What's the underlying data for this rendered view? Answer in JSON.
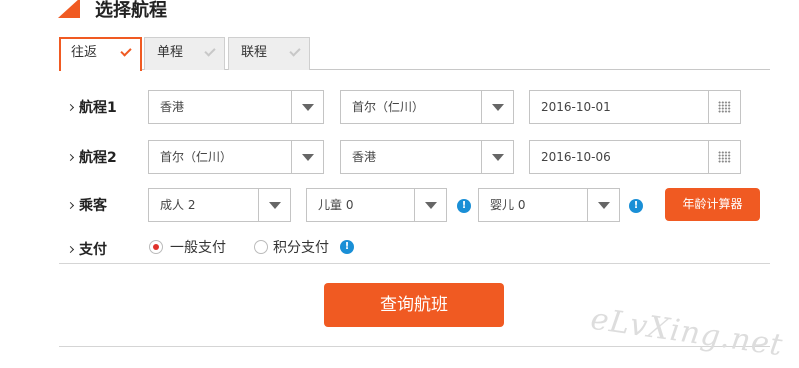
{
  "header": {
    "title": "选择航程"
  },
  "tabs": [
    {
      "label": "往返",
      "active": true
    },
    {
      "label": "单程",
      "active": false
    },
    {
      "label": "联程",
      "active": false
    }
  ],
  "segments": [
    {
      "label": "航程1",
      "from": "香港",
      "to": "首尔（仁川）",
      "date": "2016-10-01"
    },
    {
      "label": "航程2",
      "from": "首尔（仁川）",
      "to": "香港",
      "date": "2016-10-06"
    }
  ],
  "passengers": {
    "label": "乘客",
    "adult": "成人 2",
    "child": "儿童 0",
    "infant": "婴儿 0",
    "age_calc_label": "年龄计算器"
  },
  "payment": {
    "label": "支付",
    "options": [
      {
        "label": "一般支付",
        "selected": true
      },
      {
        "label": "积分支付",
        "selected": false
      }
    ]
  },
  "search_button": "查询航班",
  "watermark": "eLvXing.net",
  "colors": {
    "accent": "#f05a22",
    "info": "#1a8fd6",
    "radio_on": "#e0312a"
  }
}
